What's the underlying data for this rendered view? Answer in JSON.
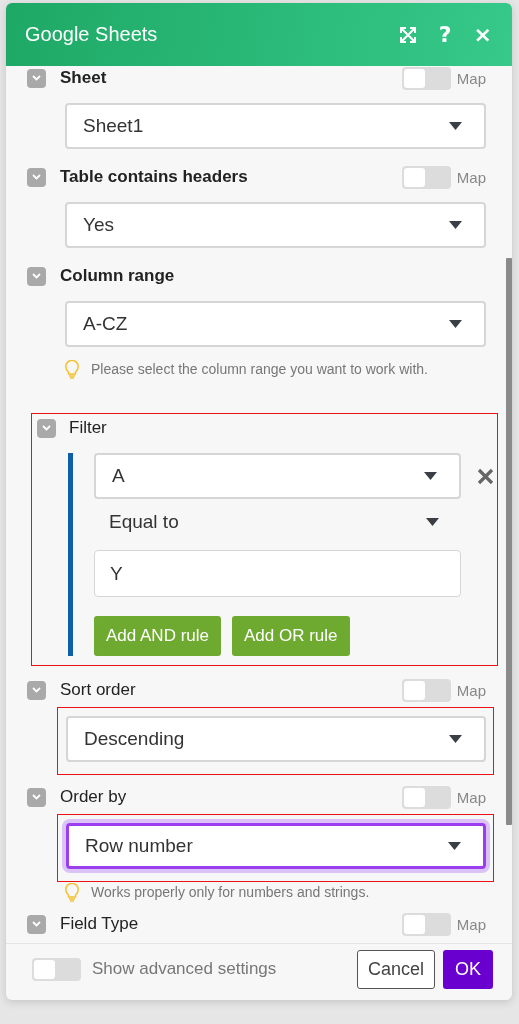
{
  "window": {
    "title": "Google Sheets",
    "actions": [
      {
        "kind": "expand"
      },
      {
        "kind": "help",
        "glyph": "?"
      },
      {
        "kind": "close",
        "glyph": "×"
      }
    ]
  },
  "fields": [
    {
      "kind": "select",
      "label": "Sheet",
      "required": true,
      "map": {
        "label": "Map",
        "on": false
      },
      "value": "Sheet1",
      "highlighted": false,
      "focused": false
    },
    {
      "kind": "select",
      "label": "Table contains headers",
      "required": true,
      "map": {
        "label": "Map",
        "on": false
      },
      "value": "Yes",
      "highlighted": false,
      "focused": false
    },
    {
      "kind": "select",
      "label": "Column range",
      "required": true,
      "value": "A-CZ",
      "highlighted": false,
      "focused": false,
      "hint": "Please select the column range you want to work with."
    },
    {
      "kind": "filter",
      "label": "Filter",
      "required": false,
      "highlighted": true,
      "rules": [
        {
          "column": "A",
          "operator": "Equal to",
          "value": "Y"
        }
      ],
      "buttons": [
        "Add AND rule",
        "Add OR rule"
      ]
    },
    {
      "kind": "select",
      "label": "Sort order",
      "required": false,
      "map": {
        "label": "Map",
        "on": false
      },
      "value": "Descending",
      "highlighted": true,
      "focused": false
    },
    {
      "kind": "select",
      "label": "Order by",
      "required": false,
      "map": {
        "label": "Map",
        "on": false
      },
      "value": "Row number",
      "highlighted": true,
      "focused": true,
      "hint": "Works properly only for numbers and strings."
    },
    {
      "kind": "select",
      "label": "Field Type",
      "required": false,
      "map": {
        "label": "Map",
        "on": false
      }
    }
  ],
  "footer": {
    "advanced": {
      "label": "Show advanced settings",
      "on": false
    },
    "buttons": [
      {
        "label": "Cancel",
        "kind": "secondary"
      },
      {
        "label": "OK",
        "kind": "primary"
      }
    ]
  }
}
